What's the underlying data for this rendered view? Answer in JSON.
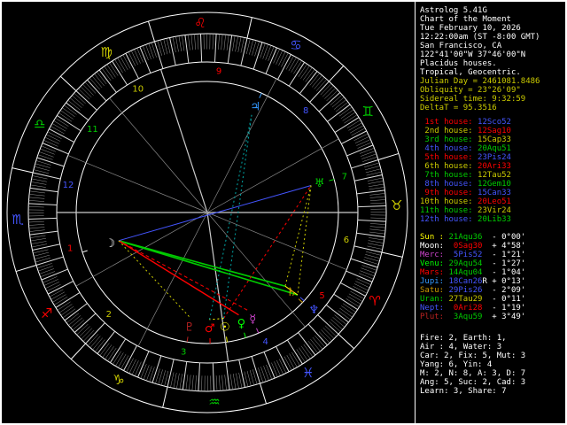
{
  "app": {
    "name": "Astrolog",
    "version_line": "Astrolog 5.41G"
  },
  "colors": {
    "background": "#000000",
    "frame": "#ffffff",
    "fire": "#ff0000",
    "earth": "#cccc00",
    "air": "#00cc00",
    "water": "#4455ff",
    "header_accent": "#cccc00"
  },
  "panel": {
    "header": [
      {
        "text": "Astrolog 5.41G",
        "color": "#ffffff"
      },
      {
        "text": "Chart of the Moment",
        "color": "#ffffff"
      },
      {
        "text": "Tue February 10, 2026",
        "color": "#ffffff"
      },
      {
        "text": "12:22:00am (ST -8:00 GMT)",
        "color": "#ffffff"
      },
      {
        "text": "San Francisco, CA",
        "color": "#ffffff"
      },
      {
        "text": "122°41'00\"W 37°46'00\"N",
        "color": "#ffffff"
      },
      {
        "text": "Placidus houses.",
        "color": "#ffffff"
      },
      {
        "text": "Tropical, Geocentric.",
        "color": "#ffffff"
      },
      {
        "text": "Julian Day = 2461081.8486",
        "color": "#cccc00"
      },
      {
        "text": "Obliquity = 23°26'09\"",
        "color": "#cccc00"
      },
      {
        "text": "Sidereal time: 9:32:59",
        "color": "#cccc00"
      },
      {
        "text": "DeltaT = 95.3516",
        "color": "#cccc00"
      }
    ],
    "houses": [
      {
        "label": " 1st house: ",
        "value": "12Sco52",
        "label_color": "#ff0000",
        "value_color": "#4455ff"
      },
      {
        "label": " 2nd house: ",
        "value": "12Sag10",
        "label_color": "#cccc00",
        "value_color": "#ff0000"
      },
      {
        "label": " 3rd house: ",
        "value": "15Cap33",
        "label_color": "#00cc00",
        "value_color": "#cccc00"
      },
      {
        "label": " 4th house: ",
        "value": "20Aqu51",
        "label_color": "#4455ff",
        "value_color": "#00cc00"
      },
      {
        "label": " 5th house: ",
        "value": "23Pis24",
        "label_color": "#ff0000",
        "value_color": "#4455ff"
      },
      {
        "label": " 6th house: ",
        "value": "20Ari33",
        "label_color": "#cccc00",
        "value_color": "#ff0000"
      },
      {
        "label": " 7th house: ",
        "value": "12Tau52",
        "label_color": "#00cc00",
        "value_color": "#cccc00"
      },
      {
        "label": " 8th house: ",
        "value": "12Gem10",
        "label_color": "#4455ff",
        "value_color": "#00cc00"
      },
      {
        "label": " 9th house: ",
        "value": "15Can33",
        "label_color": "#ff0000",
        "value_color": "#4455ff"
      },
      {
        "label": "10th house: ",
        "value": "20Leo51",
        "label_color": "#cccc00",
        "value_color": "#ff0000"
      },
      {
        "label": "11th house: ",
        "value": "23Vir24",
        "label_color": "#00cc00",
        "value_color": "#cccc00"
      },
      {
        "label": "12th house: ",
        "value": "20Lib33",
        "label_color": "#4455ff",
        "value_color": "#00cc00"
      }
    ],
    "planets": [
      {
        "name": "Sun : ",
        "value": "21Aqu36",
        "flag": " ",
        "lat": " - 0°00'",
        "name_color": "#ffff00",
        "value_color": "#00cc00"
      },
      {
        "name": "Moon: ",
        "value": " 0Sag30",
        "flag": " ",
        "lat": " + 4°58'",
        "name_color": "#ffffff",
        "value_color": "#ff0000"
      },
      {
        "name": "Merc: ",
        "value": " 5Pis52",
        "flag": " ",
        "lat": " - 1°21'",
        "name_color": "#cc44cc",
        "value_color": "#4455ff"
      },
      {
        "name": "Venu: ",
        "value": "29Aqu54",
        "flag": " ",
        "lat": " - 1°27'",
        "name_color": "#00ff00",
        "value_color": "#00cc00"
      },
      {
        "name": "Mars: ",
        "value": "14Aqu04",
        "flag": " ",
        "lat": " - 1°04'",
        "name_color": "#ff0000",
        "value_color": "#00cc00"
      },
      {
        "name": "Jupi: ",
        "value": "18Can26",
        "flag": "R",
        "lat": " + 0°13'",
        "name_color": "#3399ff",
        "value_color": "#4455ff"
      },
      {
        "name": "Satu: ",
        "value": "29Pis26",
        "flag": " ",
        "lat": " - 2°09'",
        "name_color": "#cc9900",
        "value_color": "#4455ff"
      },
      {
        "name": "Uran: ",
        "value": "27Tau29",
        "flag": " ",
        "lat": " - 0°11'",
        "name_color": "#00cc00",
        "value_color": "#cccc00"
      },
      {
        "name": "Nept: ",
        "value": " 0Ari28",
        "flag": " ",
        "lat": " - 1°19'",
        "name_color": "#4455ff",
        "value_color": "#ff0000"
      },
      {
        "name": "Plut: ",
        "value": " 3Aqu59",
        "flag": " ",
        "lat": " + 3°49'",
        "name_color": "#bb2222",
        "value_color": "#00cc00"
      }
    ],
    "stats": [
      "Fire: 2, Earth: 1,",
      "Air : 4, Water: 3",
      "Car: 2, Fix: 5, Mut: 3",
      "Yang: 6, Yin: 4",
      "M: 2, N: 8, A: 3, D: 7",
      "Ang: 5, Suc: 2, Cad: 3",
      "Learn: 3, Share: 7"
    ]
  },
  "wheel": {
    "asc": 222.867,
    "signs": [
      {
        "name": "aries",
        "glyph": "♈",
        "color": "#ff0000"
      },
      {
        "name": "taurus",
        "glyph": "♉",
        "color": "#cccc00"
      },
      {
        "name": "gemini",
        "glyph": "♊",
        "color": "#00cc00"
      },
      {
        "name": "cancer",
        "glyph": "♋",
        "color": "#4455ff"
      },
      {
        "name": "leo",
        "glyph": "♌",
        "color": "#ff0000"
      },
      {
        "name": "virgo",
        "glyph": "♍",
        "color": "#cccc00"
      },
      {
        "name": "libra",
        "glyph": "♎",
        "color": "#00cc00"
      },
      {
        "name": "scorpio",
        "glyph": "♏",
        "color": "#4455ff"
      },
      {
        "name": "sagittarius",
        "glyph": "♐",
        "color": "#ff0000"
      },
      {
        "name": "capricorn",
        "glyph": "♑",
        "color": "#cccc00"
      },
      {
        "name": "aquarius",
        "glyph": "♒",
        "color": "#00cc00"
      },
      {
        "name": "pisces",
        "glyph": "♓",
        "color": "#4455ff"
      }
    ],
    "house_cusps": [
      222.867,
      252.167,
      285.55,
      320.85,
      353.4,
      20.55,
      42.867,
      72.167,
      105.55,
      150.85,
      173.4,
      200.55
    ],
    "planets": [
      {
        "name": "sun",
        "glyph": "☉",
        "lon": 321.6,
        "color": "#ffff00"
      },
      {
        "name": "moon",
        "glyph": "☽",
        "lon": 240.5,
        "color": "#ffffff",
        "r": 115
      },
      {
        "name": "mercury",
        "glyph": "☿",
        "lon": 335.867,
        "color": "#cc44cc"
      },
      {
        "name": "venus",
        "glyph": "♀",
        "lon": 329.9,
        "color": "#00ff00"
      },
      {
        "name": "mars",
        "glyph": "♂",
        "lon": 314.067,
        "color": "#ff0000"
      },
      {
        "name": "jupiter",
        "glyph": "♃",
        "lon": 108.433,
        "color": "#3399ff"
      },
      {
        "name": "saturn",
        "glyph": "♄",
        "lon": 359.433,
        "color": "#cc9900"
      },
      {
        "name": "uranus",
        "glyph": "♅",
        "lon": 57.483,
        "color": "#00cc00"
      },
      {
        "name": "neptune",
        "glyph": "♆",
        "lon": 0.467,
        "color": "#4455ff",
        "r": 163
      },
      {
        "name": "pluto",
        "glyph": "♇",
        "lon": 303.983,
        "color": "#bb2222"
      }
    ],
    "aspects": [
      {
        "a": 1,
        "b": 6,
        "color": "#00cc00",
        "dash": "",
        "w": 1.6
      },
      {
        "a": 1,
        "b": 8,
        "color": "#00cc00",
        "dash": "",
        "w": 1.6
      },
      {
        "a": 1,
        "b": 3,
        "color": "#ff0000",
        "dash": "",
        "w": 1.4
      },
      {
        "a": 1,
        "b": 2,
        "color": "#ff0000",
        "dash": "4,3",
        "w": 1
      },
      {
        "a": 1,
        "b": 7,
        "color": "#4455ff",
        "dash": "",
        "w": 1
      },
      {
        "a": 0,
        "b": 7,
        "color": "#ff0000",
        "dash": "3,3",
        "w": 1
      },
      {
        "a": 0,
        "b": 5,
        "color": "#00aaaa",
        "dash": "2,3",
        "w": 1
      },
      {
        "a": 4,
        "b": 5,
        "color": "#00aaaa",
        "dash": "2,3",
        "w": 1
      },
      {
        "a": 1,
        "b": 9,
        "color": "#cccc00",
        "dash": "2,3",
        "w": 1
      },
      {
        "a": 7,
        "b": 8,
        "color": "#cccc00",
        "dash": "2,3",
        "w": 1
      },
      {
        "a": 7,
        "b": 6,
        "color": "#cccc00",
        "dash": "2,3",
        "w": 1
      },
      {
        "a": 6,
        "b": 8,
        "color": "#ffff00",
        "dash": "",
        "w": 1
      },
      {
        "a": 0,
        "b": 4,
        "color": "#ffff00",
        "dash": "2,3",
        "w": 1
      }
    ]
  }
}
